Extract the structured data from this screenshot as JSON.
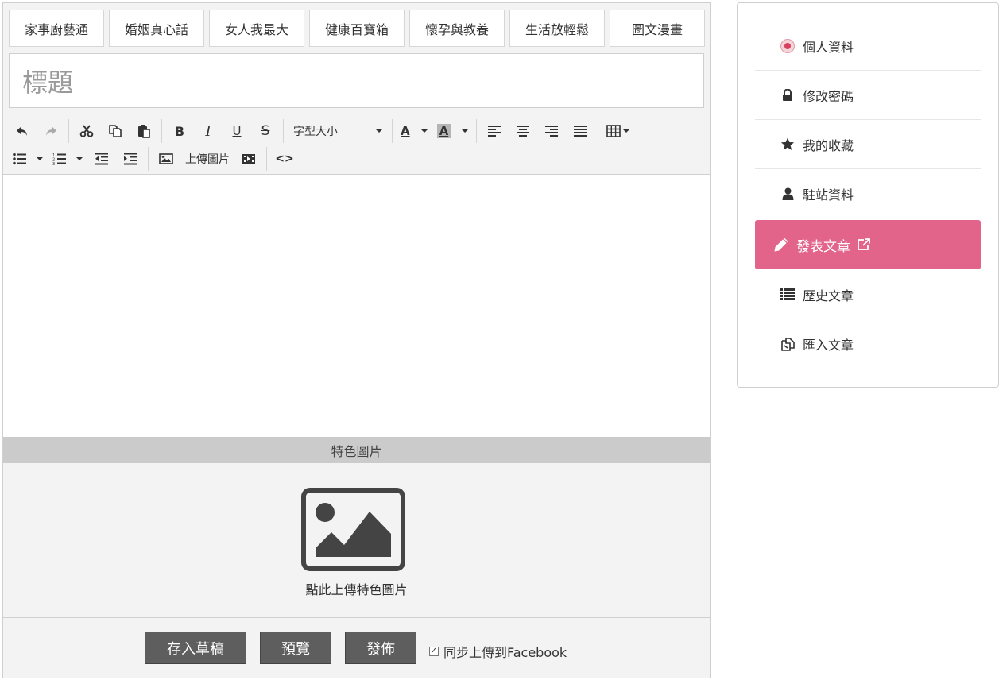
{
  "categories": [
    "家事廚藝通",
    "婚姻真心話",
    "女人我最大",
    "健康百寶箱",
    "懷孕與教養",
    "生活放輕鬆",
    "圖文漫畫"
  ],
  "title_placeholder": "標題",
  "toolbar": {
    "font_size_label": "字型大小",
    "font_color_label": "A",
    "bg_color_label": "A",
    "bold_label": "B",
    "italic_label": "I",
    "underline_label": "U",
    "strike_label": "S",
    "upload_image_label": "上傳圖片",
    "code_label": "<>"
  },
  "featured": {
    "bar_label": "特色圖片",
    "upload_text": "點此上傳特色圖片"
  },
  "footer": {
    "draft_label": "存入草稿",
    "preview_label": "預覽",
    "publish_label": "發佈",
    "fb_sync_label": "同步上傳到Facebook",
    "fb_sync_checked": true
  },
  "sidebar": {
    "items": [
      {
        "label": "個人資料",
        "icon": "avatar-icon"
      },
      {
        "label": "修改密碼",
        "icon": "lock-icon"
      },
      {
        "label": "我的收藏",
        "icon": "star-icon"
      },
      {
        "label": "駐站資料",
        "icon": "user-icon"
      },
      {
        "label": "發表文章",
        "icon": "pencil-icon",
        "active": true
      },
      {
        "label": "歷史文章",
        "icon": "list-icon"
      },
      {
        "label": "匯入文章",
        "icon": "import-icon"
      }
    ]
  },
  "colors": {
    "accent": "#e2648a",
    "button_dark": "#5e5e5e",
    "feature_bar": "#cbcbcb"
  }
}
